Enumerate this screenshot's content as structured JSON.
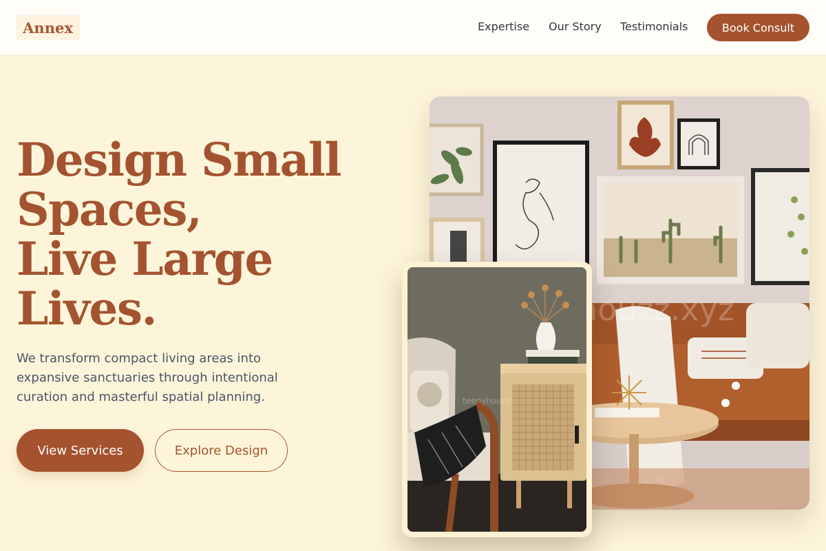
{
  "brand": {
    "logo": "Annex"
  },
  "nav": {
    "items": [
      "Expertise",
      "Our Story",
      "Testimonials"
    ],
    "cta": "Book Consult"
  },
  "hero": {
    "title_lines": [
      "Design Small",
      "Spaces,",
      "Live Large",
      "Lives."
    ],
    "lead": "We transform compact living areas into expansive sanctuaries through intentional curation and masterful spatial planning.",
    "primary_button": "View Services",
    "secondary_button": "Explore Design"
  },
  "images": {
    "main_alt": "Living room with leather sofa, gallery wall and round wooden coffee table",
    "main_watermark": "houzz.xyz",
    "side_alt": "Cane-front nightstand with dried flowers beside an armchair",
    "side_watermark": "teenyhouse"
  },
  "colors": {
    "accent": "#a5522f",
    "background": "#fdf5da",
    "header": "#fffdf8",
    "text": "#4a5568"
  }
}
